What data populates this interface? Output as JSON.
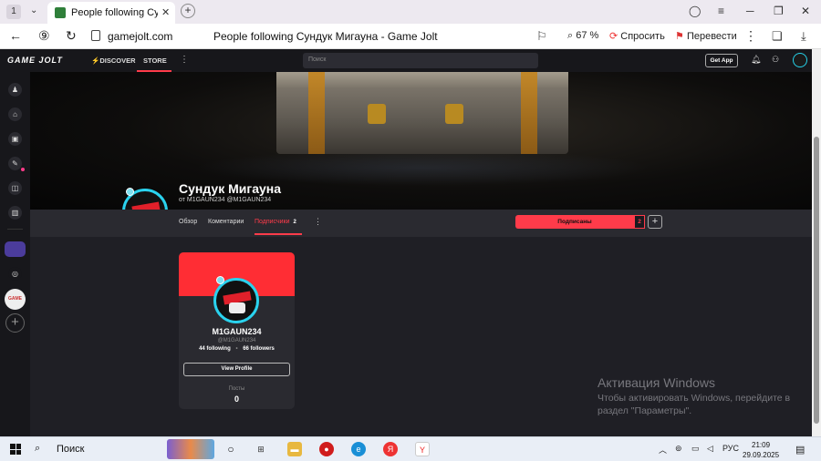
{
  "browser": {
    "tab_count": "1",
    "tab_title": "People following Сундук",
    "url": "gamejolt.com",
    "page_title": "People following Сундук Мигауна - Game Jolt",
    "zoom": "67 %",
    "ask_label": "Спросить",
    "translate_label": "Перевести"
  },
  "site": {
    "logo": "GAME JOLT",
    "discover": "DISCOVER",
    "store": "STORE",
    "search_placeholder": "Поиск",
    "get_app": "Get App"
  },
  "profile": {
    "name": "Сундук Мигауна",
    "subtitle": "от M1GAUN234 @M1GAUN234",
    "tabs": [
      {
        "label": "Обзор"
      },
      {
        "label": "Коментарии"
      },
      {
        "label": "Подписчики",
        "count": "2"
      }
    ],
    "subscribed_label": "Подписаны",
    "subscribed_count": "2",
    "plus": "+"
  },
  "follower_card": {
    "name": "M1GAUN234",
    "handle": "@M1GAUN234",
    "following": "44 following",
    "followers": "66 followers",
    "separator": "•",
    "view_profile": "View Profile",
    "posts_label": "Посты",
    "posts_count": "0"
  },
  "watermark": {
    "line1": "Активация Windows",
    "line2": "Чтобы активировать Windows, перейдите в",
    "line3": "раздел \"Параметры\"."
  },
  "taskbar": {
    "search_label": "Поиск",
    "lang": "РУС",
    "time": "21:09",
    "date": "29.09.2025"
  },
  "colors": {
    "accent": "#ff3b4a",
    "avatar_ring": "#2ad2ee",
    "background": "#1f1f25"
  }
}
